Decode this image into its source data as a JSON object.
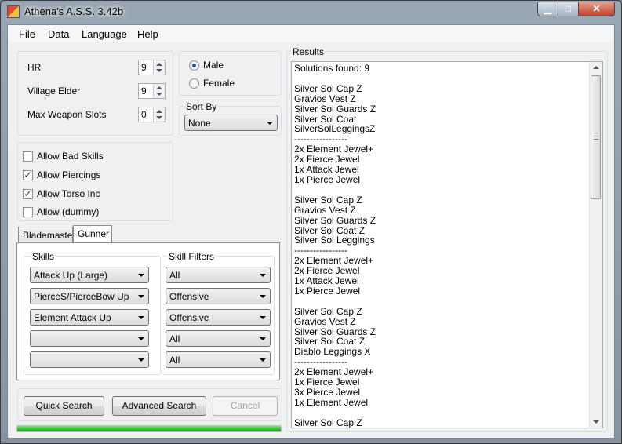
{
  "window": {
    "title": "Athena's A.S.S. 3.42b",
    "min_glyph": "▁",
    "max_glyph": "□",
    "close_glyph": "✕"
  },
  "menu": [
    "File",
    "Data",
    "Language",
    "Help"
  ],
  "params": {
    "hr": {
      "label": "HR",
      "value": "9"
    },
    "village": {
      "label": "Village Elder",
      "value": "9"
    },
    "slots": {
      "label": "Max Weapon Slots",
      "value": "0"
    }
  },
  "gender": {
    "male": "Male",
    "female": "Female",
    "selected": "Male"
  },
  "sort": {
    "label": "Sort By",
    "value": "None"
  },
  "options": [
    {
      "label": "Allow Bad Skills",
      "checked": false
    },
    {
      "label": "Allow Piercings",
      "checked": true
    },
    {
      "label": "Allow Torso Inc",
      "checked": true
    },
    {
      "label": "Allow (dummy)",
      "checked": false
    }
  ],
  "tabs": [
    "Blademaster",
    "Gunner"
  ],
  "active_tab": "Gunner",
  "skills": {
    "label": "Skills",
    "items": [
      "Attack Up (Large)",
      "PierceS/PierceBow Up",
      "Element Attack Up",
      "",
      ""
    ]
  },
  "filters": {
    "label": "Skill Filters",
    "items": [
      "All",
      "Offensive",
      "Offensive",
      "All",
      "All"
    ]
  },
  "buttons": {
    "quick": "Quick Search",
    "advanced": "Advanced Search",
    "cancel": "Cancel"
  },
  "progress": {
    "percent": 100
  },
  "results": {
    "label": "Results",
    "text": "Solutions found: 9\n\nSilver Sol Cap Z\nGravios Vest Z\nSilver Sol Guards Z\nSilver Sol Coat\nSilverSolLeggingsZ\n-----------------\n2x Element Jewel+\n2x Fierce Jewel\n1x Attack Jewel\n1x Pierce Jewel\n\nSilver Sol Cap Z\nGravios Vest Z\nSilver Sol Guards Z\nSilver Sol Coat Z\nSilver Sol Leggings\n-----------------\n2x Element Jewel+\n2x Fierce Jewel\n1x Attack Jewel\n1x Pierce Jewel\n\nSilver Sol Cap Z\nGravios Vest Z\nSilver Sol Guards Z\nSilver Sol Coat Z\nDiablo Leggings X\n-----------------\n2x Element Jewel+\n1x Fierce Jewel\n3x Pierce Jewel\n1x Element Jewel\n\nSilver Sol Cap Z"
  },
  "colors": {
    "progress": "#2fbf31",
    "title_bar": "#9aa7b4",
    "close_button": "#c0402b"
  }
}
